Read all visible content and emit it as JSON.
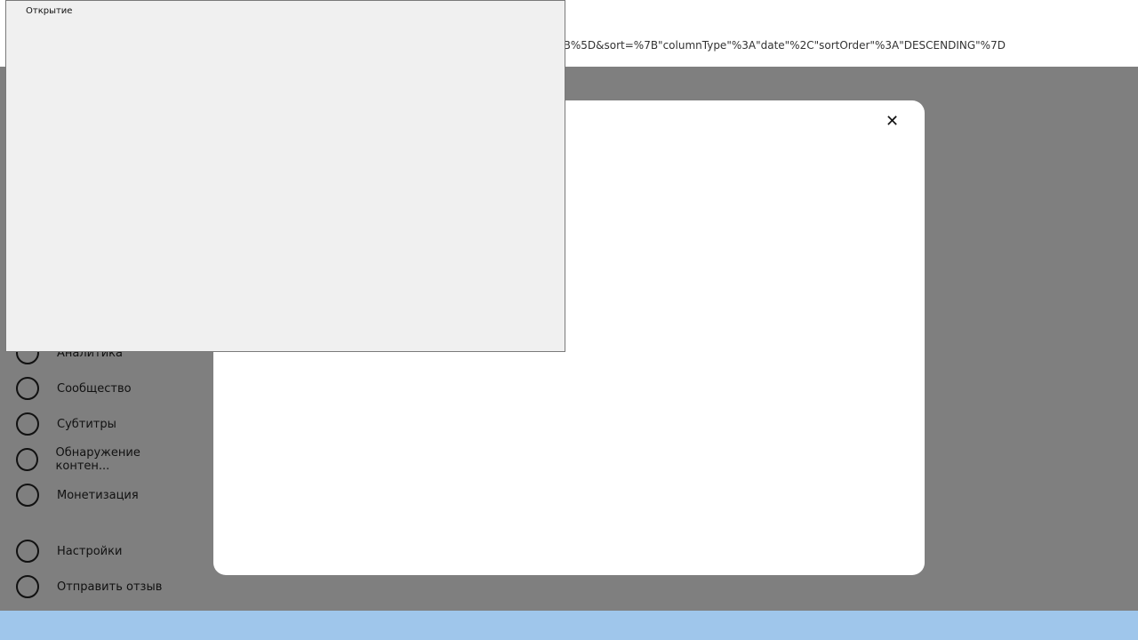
{
  "browser": {
    "address_fragment": "5B%5D&sort=%7B\"columnType\"%3A\"date\"%2C\"sortOrder\"%3A\"DESCENDING\"%7D"
  },
  "sidebar": {
    "items": [
      {
        "label": "Аналитика"
      },
      {
        "label": "Сообщество"
      },
      {
        "label": "Субтитры"
      },
      {
        "label": "Обнаружение контен..."
      },
      {
        "label": "Монетизация"
      },
      {
        "label": "Настройки"
      },
      {
        "label": "Отправить отзыв"
      }
    ]
  },
  "dialog": {
    "title": "Открытие"
  }
}
